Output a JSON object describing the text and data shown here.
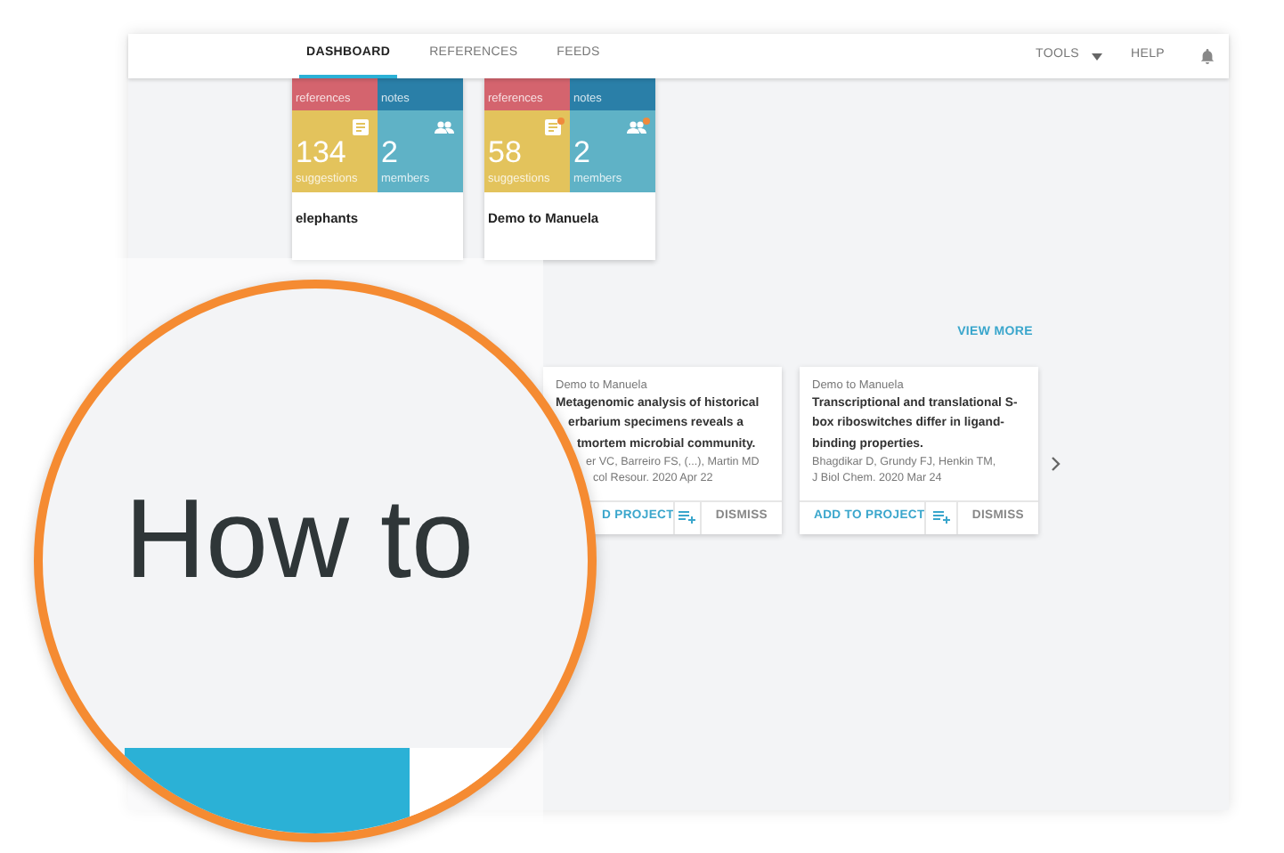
{
  "nav": {
    "tabs": [
      {
        "label": "DASHBOARD",
        "selected": true
      },
      {
        "label": "REFERENCES",
        "selected": false
      },
      {
        "label": "FEEDS",
        "selected": false
      }
    ],
    "tools": "TOOLS",
    "help": "HELP"
  },
  "projects": [
    {
      "name": "elephants",
      "tiles": [
        {
          "kind": "references",
          "label": "references"
        },
        {
          "kind": "notes",
          "label": "notes"
        },
        {
          "kind": "suggestions",
          "value": "134",
          "label": "suggestions",
          "new": false
        },
        {
          "kind": "members",
          "value": "2",
          "label": "members",
          "new": false
        }
      ]
    },
    {
      "name": "Demo to Manuela",
      "tiles": [
        {
          "kind": "references",
          "label": "references"
        },
        {
          "kind": "notes",
          "label": "notes"
        },
        {
          "kind": "suggestions",
          "value": "58",
          "label": "suggestions",
          "new": true
        },
        {
          "kind": "members",
          "value": "2",
          "label": "members",
          "new": true
        }
      ]
    }
  ],
  "feed": {
    "view_more": "VIEW MORE",
    "articles": [
      {
        "project": "Demo to Manuela",
        "title_lines": [
          "Metagenomic analysis of historical",
          "erbarium specimens reveals a",
          "tmortem microbial community."
        ],
        "authors": "er VC, Barreiro FS, (...), Martin MD",
        "journal": "col Resour. 2020 Apr 22",
        "add": "D PROJECT",
        "dismiss": "DISMISS"
      },
      {
        "project": "Demo to Manuela",
        "title_lines": [
          "Transcriptional and translational S-",
          "box riboswitches differ in ligand-",
          "binding properties."
        ],
        "authors": "Bhagdikar D, Grundy FJ, Henkin TM,",
        "journal": "J Biol Chem. 2020 Mar 24",
        "add": "ADD TO PROJECT",
        "dismiss": "DISMISS"
      }
    ]
  },
  "magnifier": {
    "heading": "How to"
  }
}
